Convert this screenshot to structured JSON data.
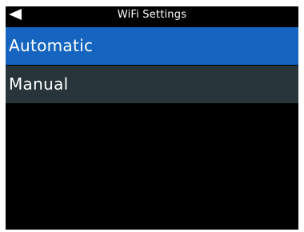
{
  "header": {
    "title": "WiFi Settings",
    "back_icon": "back-arrow-icon"
  },
  "menu": {
    "items": [
      {
        "label": "Automatic",
        "selected": true
      },
      {
        "label": "Manual",
        "selected": false
      }
    ]
  },
  "colors": {
    "screen_bg": "#000000",
    "selected_bg": "#1565c0",
    "item_bg": "#27343a",
    "text": "#ffffff"
  }
}
